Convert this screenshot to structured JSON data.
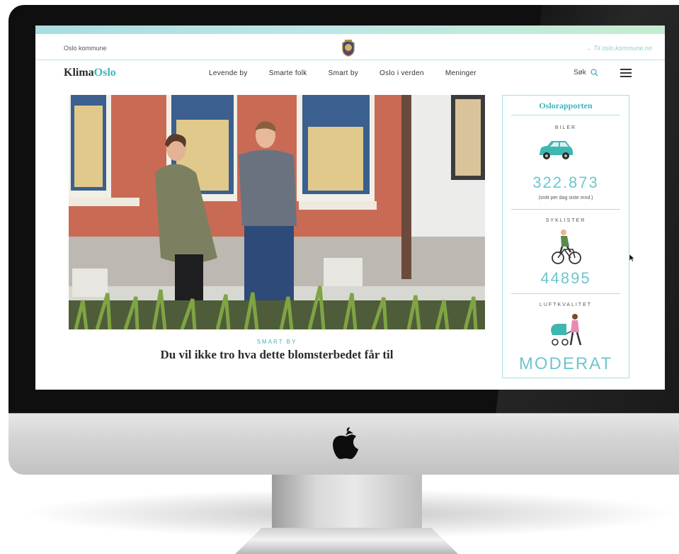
{
  "site": {
    "org": "Oslo kommune",
    "external_link": "→ Til oslo.kommune.no",
    "logo_part1": "Klima",
    "logo_part2": "Oslo"
  },
  "nav": {
    "items": [
      "Levende by",
      "Smarte folk",
      "Smart by",
      "Oslo i verden",
      "Meninger"
    ],
    "search_label": "Søk"
  },
  "article": {
    "category": "SMART BY",
    "headline": "Du vil ikke tro hva dette blomsterbedet får til"
  },
  "report": {
    "title": "Oslorapporten",
    "cars": {
      "label": "BILER",
      "value": "322.873",
      "note": "(snitt per dag siste mnd.)"
    },
    "cyclists": {
      "label": "SYKLISTER",
      "value": "44895"
    },
    "air": {
      "label": "LUFTKVALITET",
      "value": "MODERAT"
    }
  },
  "colors": {
    "accent": "#3fb3bd",
    "value_teal": "#6cc7cd",
    "car": "#3fb7b1",
    "topbar": "#bfe7e4"
  },
  "icons": [
    "oslo-crest-icon",
    "search-icon",
    "hamburger-menu-icon",
    "car-icon",
    "cyclist-icon",
    "stroller-icon",
    "apple-logo-icon",
    "mouse-cursor-icon"
  ]
}
